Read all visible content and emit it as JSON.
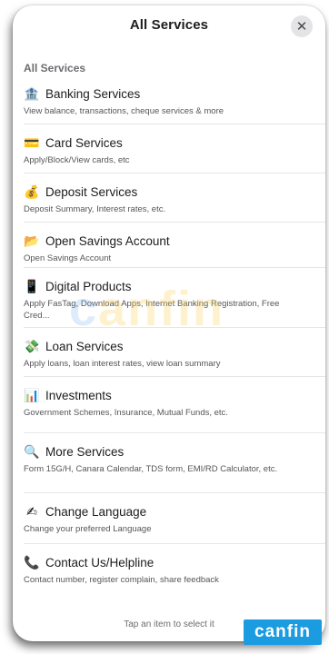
{
  "header": {
    "title": "All Services",
    "close_icon": "close-icon",
    "close_glyph": "✕"
  },
  "section_label": "All Services",
  "items": [
    {
      "icon": "bank-icon",
      "glyph": "🏦",
      "label": "Banking Services",
      "desc": "View balance, transactions, cheque services & more"
    },
    {
      "icon": "card-icon",
      "glyph": "💳",
      "label": "Card Services",
      "desc": "Apply/Block/View cards, etc"
    },
    {
      "icon": "money-bag-icon",
      "glyph": "💰",
      "label": "Deposit Services",
      "desc": "Deposit Summary, Interest rates, etc."
    },
    {
      "icon": "folder-icon",
      "glyph": "📂",
      "label": "Open Savings Account",
      "desc": "Open Savings Account"
    },
    {
      "icon": "phone-icon",
      "glyph": "📱",
      "label": "Digital Products",
      "desc": "Apply FasTag, Download Apps, Internet Banking Registration, Free Cred..."
    },
    {
      "icon": "flying-money-icon",
      "glyph": "💸",
      "label": "Loan Services",
      "desc": "Apply loans, loan interest rates, view loan summary"
    },
    {
      "icon": "chart-icon",
      "glyph": "📊",
      "label": "Investments",
      "desc": "Government Schemes, Insurance, Mutual Funds, etc."
    },
    {
      "icon": "magnifier-icon",
      "glyph": "🔍",
      "label": "More Services",
      "desc": "Form 15G/H, Canara Calendar, TDS form, EMI/RD Calculator, etc."
    },
    {
      "icon": "writing-hand-icon",
      "glyph": "✍",
      "label": "Change Language",
      "desc": "Change your preferred Language"
    },
    {
      "icon": "telephone-icon",
      "glyph": "📞",
      "label": "Contact Us/Helpline",
      "desc": "Contact number, register complain, share feedback"
    }
  ],
  "footer": "Tap an item to select it",
  "watermark": "canfin",
  "brand_logo": "canfin"
}
